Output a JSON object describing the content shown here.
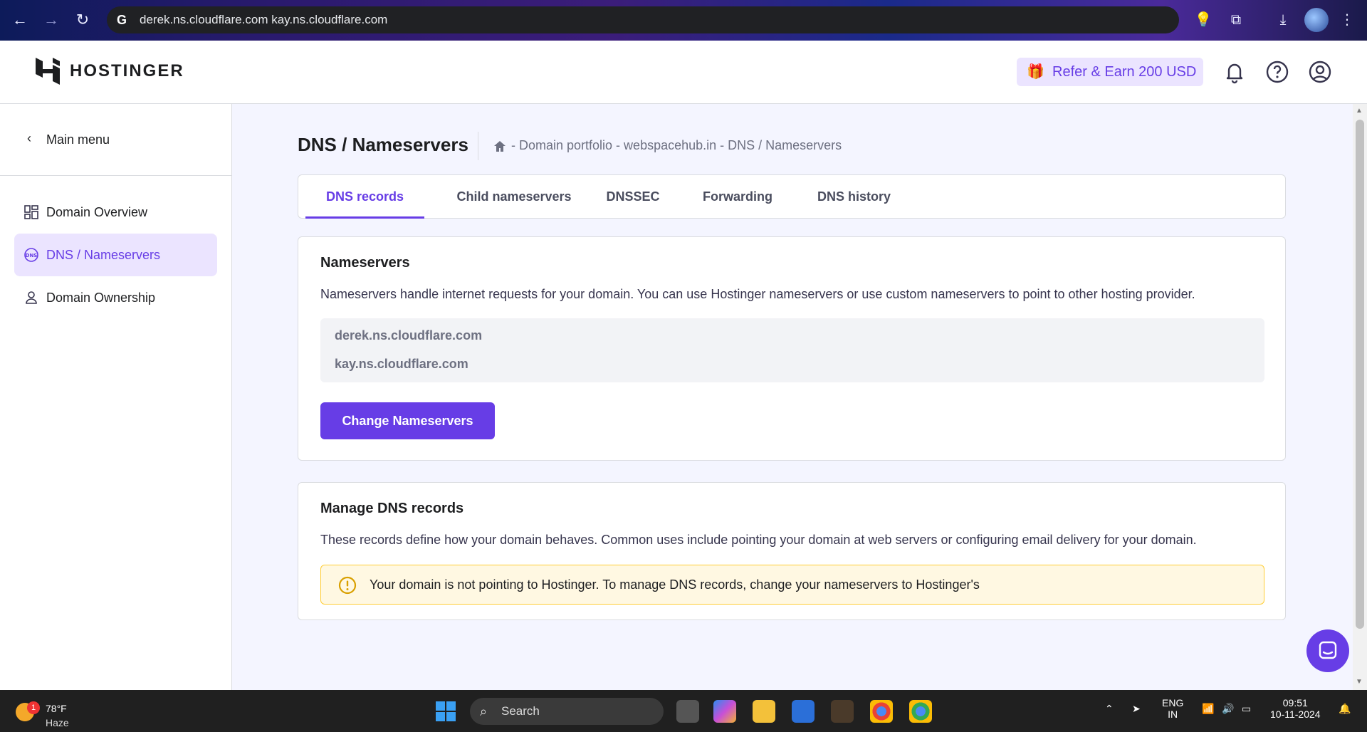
{
  "browser": {
    "address": "derek.ns.cloudflare.com kay.ns.cloudflare.com",
    "search_engine_glyph": "G"
  },
  "header": {
    "brand": "HOSTINGER",
    "refer_label": "Refer & Earn 200 USD"
  },
  "sidebar": {
    "back_label": "Main menu",
    "items": [
      {
        "label": "Domain Overview",
        "icon": "dashboard-icon"
      },
      {
        "label": "DNS / Nameservers",
        "icon": "dns-icon",
        "active": true
      },
      {
        "label": "Domain Ownership",
        "icon": "person-icon"
      }
    ]
  },
  "page": {
    "title": "DNS / Nameservers",
    "breadcrumb": "- Domain portfolio - webspacehub.in - DNS / Nameservers"
  },
  "tabs": [
    {
      "label": "DNS records",
      "active": true
    },
    {
      "label": "Child nameservers"
    },
    {
      "label": "DNSSEC"
    },
    {
      "label": "Forwarding"
    },
    {
      "label": "DNS history"
    }
  ],
  "nameservers": {
    "title": "Nameservers",
    "description": "Nameservers handle internet requests for your domain. You can use Hostinger nameservers or use custom nameservers to point to other hosting provider.",
    "list": [
      "derek.ns.cloudflare.com",
      "kay.ns.cloudflare.com"
    ],
    "button": "Change Nameservers"
  },
  "dns_records": {
    "title": "Manage DNS records",
    "description": "These records define how your domain behaves. Common uses include pointing your domain at web servers or configuring email delivery for your domain.",
    "alert": "Your domain is not pointing to Hostinger. To manage DNS records, change your nameservers to Hostinger's"
  },
  "taskbar": {
    "temperature": "78°F",
    "condition": "Haze",
    "weather_badge": "1",
    "search_label": "Search",
    "lang_top": "ENG",
    "lang_bottom": "IN",
    "time": "09:51",
    "date": "10-11-2024"
  },
  "colors": {
    "accent": "#673de6",
    "accent_light": "#ebe4ff",
    "alert_bg": "#fff8e2",
    "alert_border": "#ffcd35"
  }
}
